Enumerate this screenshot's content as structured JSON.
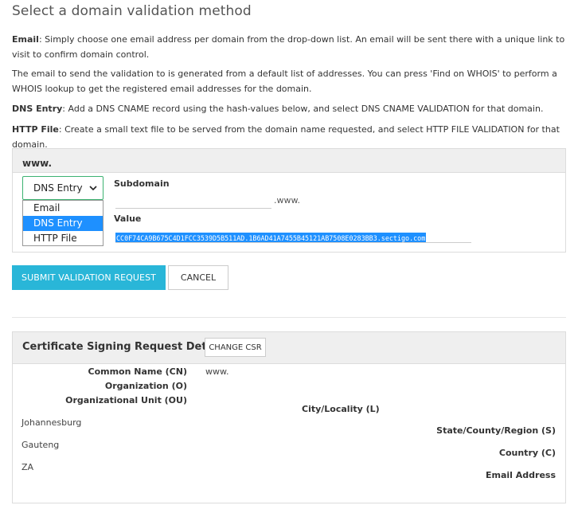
{
  "page_title": "Select a domain validation method",
  "instructions": {
    "email_label": "Email",
    "email_text": ": Simply choose one email address per domain from the drop-down list. An email will be sent there with a unique link to visit to confirm domain control.",
    "email_note": "The email to send the validation to is generated from a default list of addresses. You can press 'Find on WHOIS' to perform a WHOIS lookup to get the registered email addresses for the domain.",
    "dns_label": "DNS Entry",
    "dns_text": ": Add a DNS CNAME record using the hash-values below, and select DNS CNAME VALIDATION for that domain.",
    "http_label": "HTTP File",
    "http_text": ": Create a small text file to be served from the domain name requested, and select HTTP FILE VALIDATION for that domain."
  },
  "domain_panel": {
    "domain": "www.",
    "method_select": {
      "selected": "DNS Entry",
      "options": [
        "Email",
        "DNS Entry",
        "HTTP File"
      ],
      "highlighted": "DNS Entry"
    },
    "subdomain_label": "Subdomain",
    "subdomain_value": "",
    "subdomain_suffix": ".www.",
    "value_label": "Value",
    "value_text": "CC0F74CA9B675C4D1FCC3539D5B511AD.1B6AD41A7455B45121AB7508E0283BB3.sectigo.com"
  },
  "actions": {
    "submit_label": "SUBMIT VALIDATION REQUEST",
    "cancel_label": "CANCEL"
  },
  "csr": {
    "title": "Certificate Signing Request Details",
    "change_label": "CHANGE CSR",
    "common_name_label": "Common Name (CN)",
    "common_name_value": "www.",
    "organization_label": "Organization (O)",
    "org_unit_label": "Organizational Unit (OU)",
    "city_label": "City/Locality (L)",
    "city_value": "Johannesburg",
    "state_label": "State/County/Region (S)",
    "state_value": "Gauteng",
    "country_label": "Country (C)",
    "country_value": "ZA",
    "email_label": "Email Address"
  },
  "colors": {
    "primary_button": "#29b6d8",
    "select_border": "#3cb371",
    "selection_highlight": "#1e90ff"
  }
}
